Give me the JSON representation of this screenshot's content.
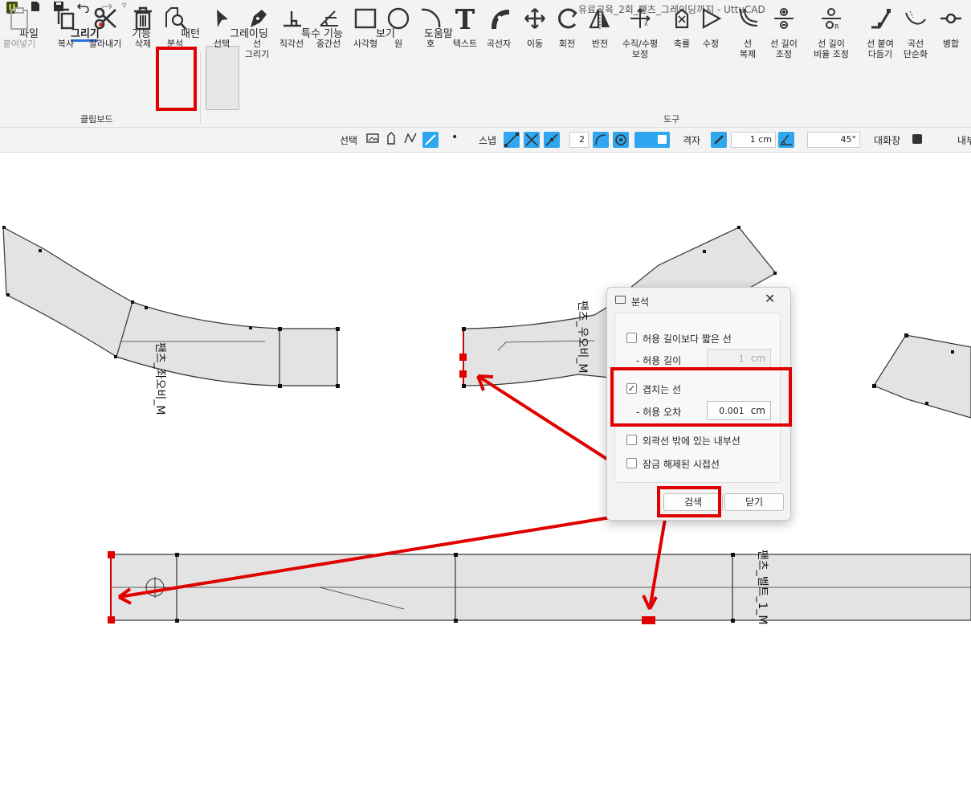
{
  "window": {
    "title": "유료교육_2회_팬츠_그레이딩까지 - UttuCAD",
    "logo": "U"
  },
  "quick_access": [
    {
      "name": "new-file-icon",
      "glyph": "▆"
    },
    {
      "name": "save-icon",
      "glyph": "▆"
    },
    {
      "name": "undo-icon",
      "glyph": "↶"
    },
    {
      "name": "redo-icon",
      "glyph": "↷"
    },
    {
      "name": "customize-dropdown-icon",
      "glyph": "▿"
    }
  ],
  "menu": [
    "파일",
    "그리기",
    "기능",
    "패턴",
    "그레이딩",
    "특수 기능",
    "보기",
    "도움말"
  ],
  "ribbon": {
    "clipboard": {
      "label": "클립보드",
      "items": [
        {
          "label": "붙여넣기",
          "disabled": true
        },
        {
          "label": "복사"
        },
        {
          "label": "잘라내기"
        },
        {
          "label": "삭제"
        },
        {
          "label": "분석"
        }
      ]
    },
    "tools": {
      "label": "도구",
      "items": [
        {
          "label": "선택"
        },
        {
          "label": "선\n그리기"
        },
        {
          "label": "직각선"
        },
        {
          "label": "중간선"
        },
        {
          "label": "사각형"
        },
        {
          "label": "원"
        },
        {
          "label": "호"
        },
        {
          "label": "텍스트"
        },
        {
          "label": "곡선자"
        },
        {
          "label": "이동"
        },
        {
          "label": "회전"
        },
        {
          "label": "반전"
        },
        {
          "label": "수직/수평\n보정"
        },
        {
          "label": "축률"
        },
        {
          "label": "수정"
        },
        {
          "label": "선\n복제"
        },
        {
          "label": "선 길이\n조정"
        },
        {
          "label": "선 길이\n비율 조정"
        },
        {
          "label": "선 붙여\n다듬기"
        },
        {
          "label": "곡선\n단순화"
        },
        {
          "label": "병합"
        }
      ]
    }
  },
  "options_bar": {
    "select_label": "선택",
    "snap_label": "스냅",
    "snap_count": "2",
    "grid_label": "격자",
    "grid_size": "1 cm",
    "angle": "45°",
    "dialog_label": "대화창",
    "trailing_label": "내부"
  },
  "pieces": [
    {
      "label": "팬츠_좌오비_M"
    },
    {
      "label": "팬츠_우오비_M"
    },
    {
      "label": "팬츠_벨트_1_M"
    }
  ],
  "dialog": {
    "title": "분석",
    "close": "✕",
    "options": [
      {
        "label": "허용 길이보다 짧은 선",
        "checked": false
      },
      {
        "label": "겹치는 선",
        "checked": true
      },
      {
        "label": "외곽선 밖에 있는 내부선",
        "checked": false
      },
      {
        "label": "잠금 해제된 시접선",
        "checked": false
      }
    ],
    "tolerance_length": {
      "label": "- 허용 길이",
      "value": "1",
      "unit": "cm"
    },
    "tolerance_error": {
      "label": "- 허용 오차",
      "value": "0.001",
      "unit": "cm"
    },
    "search_button": "검색",
    "close_button": "닫기",
    "check_glyph": "✓"
  },
  "colors": {
    "accent_blue": "#2ea6f0",
    "highlight_red": "#e00000",
    "piece_fill": "#e3e3e3"
  }
}
